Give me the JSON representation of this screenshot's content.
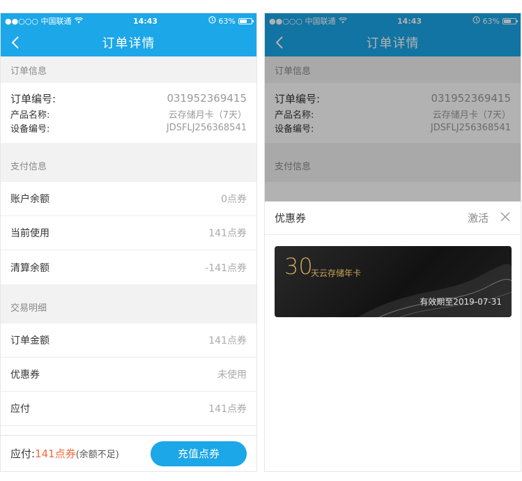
{
  "status": {
    "carrier": "●●○○○ 中国联通",
    "time": "14:43",
    "battery_text": "63%",
    "battery_level": 0.63
  },
  "nav": {
    "title": "订单详情"
  },
  "order_info": {
    "header": "订单信息",
    "order_no_label": "订单编号:",
    "order_no": "031952369415",
    "product_label": "产品名称:",
    "product": "云存储月卡（7天）",
    "device_label": "设备编号:",
    "device": "JDSFLJ256368541"
  },
  "payment": {
    "header": "支付信息",
    "rows": [
      {
        "label": "账户余额",
        "value": "0点券"
      },
      {
        "label": "当前使用",
        "value": "141点券"
      },
      {
        "label": "清算余额",
        "value": "-141点券"
      }
    ]
  },
  "transaction": {
    "header": "交易明细",
    "rows": [
      {
        "label": "订单金额",
        "value": "141点券"
      },
      {
        "label": "优惠券",
        "value": "未使用"
      },
      {
        "label": "应付",
        "value": "141点券"
      }
    ]
  },
  "bottom": {
    "pay_label": "应付:",
    "pay_amount": "141点券",
    "pay_note": "(余额不足)",
    "recharge_button": "充值点券"
  },
  "coupon_sheet": {
    "title": "优惠券",
    "activate": "激活",
    "coupon": {
      "days": "30",
      "name": "天云存储年卡",
      "validity": "有效期至2019-07-31"
    }
  },
  "colors": {
    "primary": "#1ba7e8",
    "amount": "#f26a3d",
    "gold": "#c9a35a"
  },
  "icons": [
    "back-chevron-icon",
    "wifi-icon",
    "alarm-icon",
    "battery-icon",
    "close-icon"
  ]
}
